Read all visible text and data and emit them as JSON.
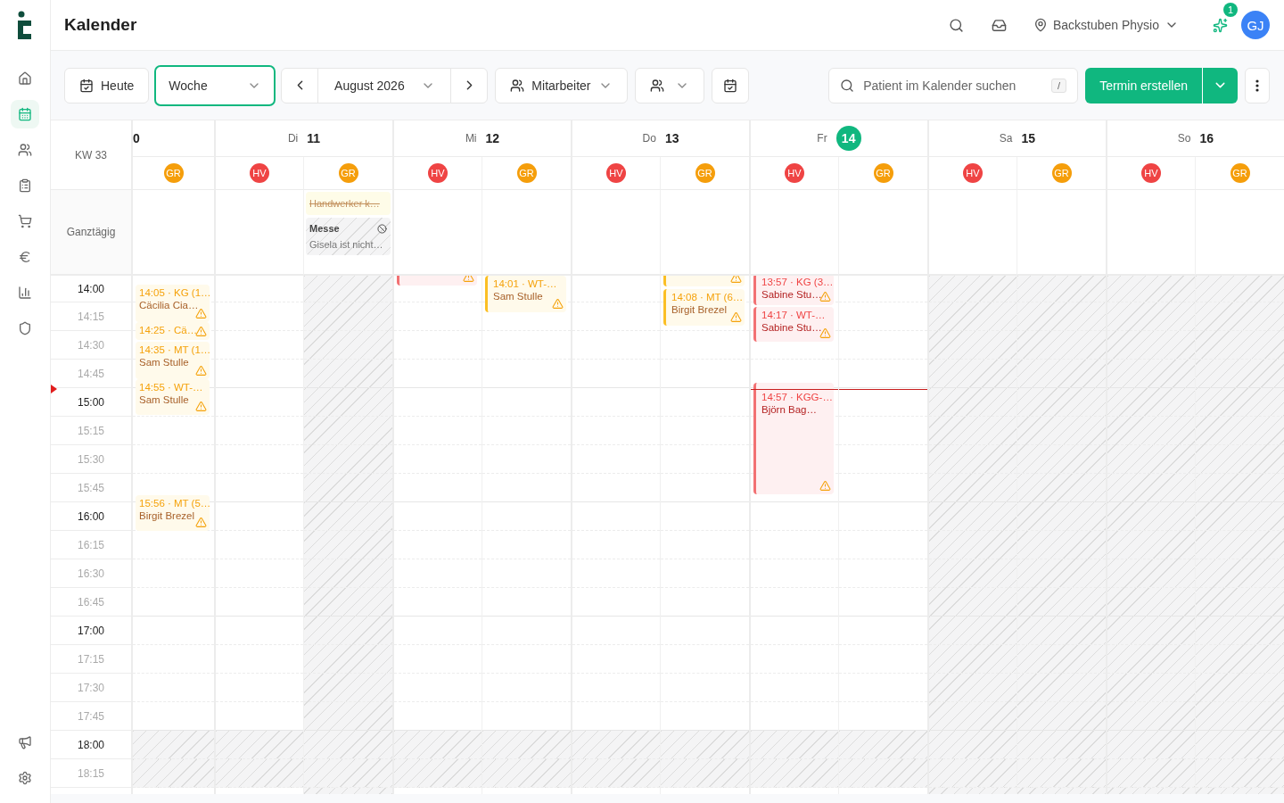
{
  "sidebar": {
    "items": [
      {
        "selected": false
      },
      {
        "selected": true
      },
      {
        "selected": false
      },
      {
        "selected": false
      },
      {
        "selected": false
      },
      {
        "selected": false
      },
      {
        "selected": false
      },
      {
        "selected": false
      }
    ],
    "bottom_items": [
      {
        "selected": false
      },
      {
        "selected": false
      }
    ]
  },
  "header": {
    "title": "Kalender",
    "location": "Backstuben Physio",
    "notification_count": "1",
    "avatar": "GJ"
  },
  "toolbar": {
    "today": "Heute",
    "view": {
      "label": "Woche",
      "focused": true
    },
    "period": "August 2026",
    "staff_filter": "Mitarbeiter",
    "search": {
      "placeholder": "Patient im Kalender suchen",
      "shortcut": "/"
    },
    "create": "Termin erstellen"
  },
  "calendar": {
    "week": "KW 33",
    "all_day_label": "Ganztägig",
    "now_line": true,
    "slots": [
      {
        "label": "14:00",
        "closed": false
      },
      {
        "label": "14:15",
        "closed": false
      },
      {
        "label": "14:30",
        "closed": false
      },
      {
        "label": "14:45",
        "closed": false
      },
      {
        "label": "15:00",
        "closed": false
      },
      {
        "label": "15:15",
        "closed": false
      },
      {
        "label": "15:30",
        "closed": false
      },
      {
        "label": "15:45",
        "closed": false
      },
      {
        "label": "16:00",
        "closed": false
      },
      {
        "label": "16:15",
        "closed": false
      },
      {
        "label": "16:30",
        "closed": false
      },
      {
        "label": "16:45",
        "closed": false
      },
      {
        "label": "17:00",
        "closed": false
      },
      {
        "label": "17:15",
        "closed": false
      },
      {
        "label": "17:30",
        "closed": false
      },
      {
        "label": "17:45",
        "closed": false
      },
      {
        "label": "18:00",
        "closed": true
      },
      {
        "label": "18:15",
        "closed": true
      }
    ],
    "days": [
      {
        "date": "0",
        "today": false,
        "staff": [
          {
            "initials": "GR",
            "color": "#f59e0b",
            "blocked": false,
            "events": [
              {
                "time": "14:05 · KG (1…",
                "patient": "Cäcilia Cia…",
                "kind": "amber",
                "accent_bar": false,
                "warning": true
              },
              {
                "time": "14:25 · Cä…",
                "kind": "amber",
                "accent_bar": false,
                "warning": true
              },
              {
                "time": "14:35 · MT (1…",
                "patient": "Sam Stulle",
                "kind": "amber",
                "accent_bar": false,
                "warning": true
              },
              {
                "time": "14:55 · WT-…",
                "patient": "Sam Stulle",
                "kind": "amber",
                "accent_bar": false,
                "warning": true
              },
              {
                "time": "15:56 · MT (5…",
                "patient": "Birgit Brezel",
                "kind": "amber",
                "accent_bar": false,
                "warning": true
              }
            ]
          }
        ]
      },
      {
        "weekday": "Di",
        "date": "11",
        "today": false,
        "staff": [
          {
            "initials": "HV",
            "color": "#ef4444",
            "blocked": false
          },
          {
            "initials": "GR",
            "color": "#f59e0b",
            "blocked": true,
            "all_day": [
              {
                "kind": "note",
                "title": "Handwerker k…",
                "cancelled": true
              },
              {
                "kind": "absence",
                "title": "Messe",
                "note": "Gisela ist nicht…"
              }
            ]
          }
        ]
      },
      {
        "weekday": "Mi",
        "date": "12",
        "today": false,
        "staff": [
          {
            "initials": "HV",
            "color": "#ef4444",
            "blocked": false,
            "events": [
              {
                "kind": "red",
                "accent_bar": true,
                "warning": true
              }
            ]
          },
          {
            "initials": "GR",
            "color": "#f59e0b",
            "blocked": false,
            "events": [
              {
                "time": "14:01 · WT-…",
                "patient": "Sam Stulle",
                "kind": "amber",
                "accent_bar": true,
                "warning": true
              }
            ]
          }
        ]
      },
      {
        "weekday": "Do",
        "date": "13",
        "today": false,
        "staff": [
          {
            "initials": "HV",
            "color": "#ef4444",
            "blocked": false
          },
          {
            "initials": "GR",
            "color": "#f59e0b",
            "blocked": false,
            "events": [
              {
                "kind": "amber",
                "accent_bar": true,
                "warning": true
              },
              {
                "time": "14:08 · MT (6…",
                "patient": "Birgit Brezel",
                "kind": "amber",
                "accent_bar": true,
                "warning": true
              }
            ]
          }
        ]
      },
      {
        "weekday": "Fr",
        "date": "14",
        "today": true,
        "staff": [
          {
            "initials": "HV",
            "color": "#ef4444",
            "blocked": false,
            "events": [
              {
                "time": "13:57 · KG (3…",
                "patient": "Sabine Stu…",
                "kind": "red",
                "accent_bar": true,
                "warning": true
              },
              {
                "time": "14:17 · WT-…",
                "patient": "Sabine Stu…",
                "kind": "red",
                "accent_bar": true,
                "warning": true
              },
              {
                "time": "14:57 · KGG-…",
                "patient": "Björn Bag…",
                "kind": "red",
                "accent_bar": true,
                "warning": true
              }
            ]
          },
          {
            "initials": "GR",
            "color": "#f59e0b",
            "blocked": false
          }
        ]
      },
      {
        "weekday": "Sa",
        "date": "15",
        "today": false,
        "staff": [
          {
            "initials": "HV",
            "color": "#ef4444",
            "blocked": true
          },
          {
            "initials": "GR",
            "color": "#f59e0b",
            "blocked": true
          }
        ]
      },
      {
        "weekday": "So",
        "date": "16",
        "today": false,
        "staff": [
          {
            "initials": "HV",
            "color": "#ef4444",
            "blocked": true
          },
          {
            "initials": "GR",
            "color": "#f59e0b",
            "blocked": true
          }
        ]
      }
    ]
  }
}
